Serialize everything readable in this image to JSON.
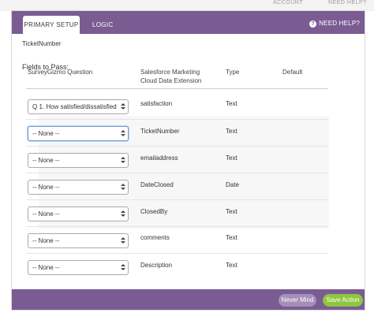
{
  "background": {
    "links": [
      "ACCOUNT",
      "NEED HELP?"
    ]
  },
  "header": {
    "tabs": [
      {
        "label": "PRIMARY SETUP",
        "active": true
      },
      {
        "label": "LOGIC",
        "active": false
      }
    ],
    "help_label": "NEED HELP?",
    "help_icon": "question-circle-icon"
  },
  "subtitle": "TicketNumber",
  "fields_title": "Fields to Pass:",
  "columns": {
    "question": "SurveyGizmo Question",
    "extension_line1": "Salesforce Marketing",
    "extension_line2": "Cloud Data Extension",
    "type": "Type",
    "default": "Default"
  },
  "rows": [
    {
      "question": "Q 1. How satisfied/dissatisfied",
      "field": "satisfaction",
      "type": "Text"
    },
    {
      "question": "-- None --",
      "field": "TicketNumber",
      "type": "Text"
    },
    {
      "question": "-- None --",
      "field": "emailaddress",
      "type": "Text"
    },
    {
      "question": "-- None --",
      "field": "DateClosed",
      "type": "Date"
    },
    {
      "question": "-- None --",
      "field": "ClosedBy",
      "type": "Text"
    },
    {
      "question": "-- None --",
      "field": "comments",
      "type": "Text"
    },
    {
      "question": "-- None --",
      "field": "Description",
      "type": "Text"
    }
  ],
  "footer": {
    "never_mind": "Never Mind",
    "save": "Save Action"
  },
  "colors": {
    "header": "#7a5c93",
    "save": "#8ec63f",
    "never_mind": "#a58fb8"
  }
}
